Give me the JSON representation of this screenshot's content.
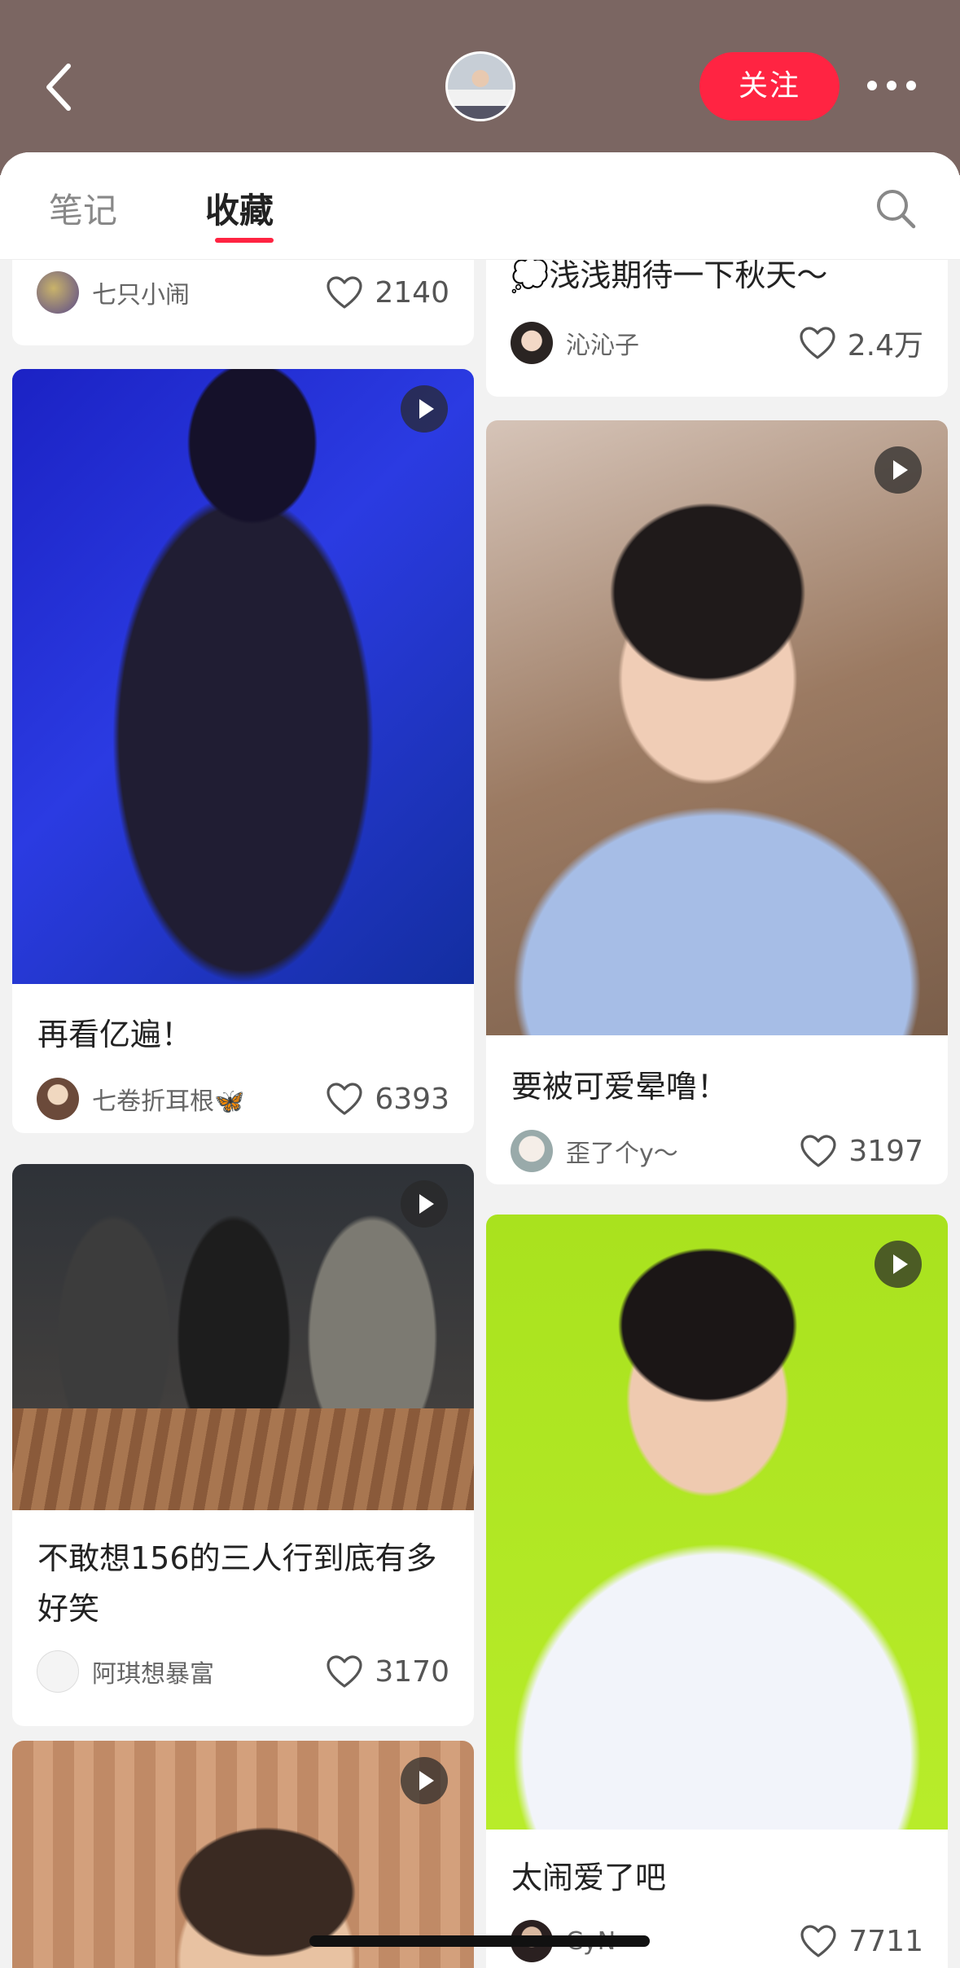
{
  "header": {
    "back_icon": "chevron-left-icon",
    "follow_label": "关注",
    "more_icon": "more-dots-icon"
  },
  "tabs": [
    {
      "label": "笔记",
      "active": false
    },
    {
      "label": "收藏",
      "active": true
    }
  ],
  "search_icon": "search-icon",
  "accent_color": "#ff2442",
  "feed": {
    "left": [
      {
        "title": "",
        "author": "七只小闹",
        "likes": "2140",
        "video": false
      },
      {
        "title": "再看亿遍！",
        "author": "七卷折耳根🦋",
        "likes": "6393",
        "video": true
      },
      {
        "title": "不敢想156的三人行到底有多好笑",
        "author": "阿琪想暴富",
        "likes": "3170",
        "video": true
      },
      {
        "title": "",
        "author": "",
        "likes": "",
        "video": true
      }
    ],
    "right": [
      {
        "title": "💭浅浅期待一下秋天～",
        "author": "沁沁子",
        "likes": "2.4万",
        "video": false
      },
      {
        "title": "要被可爱晕噜！",
        "author": "歪了个y～",
        "likes": "3197",
        "video": true
      },
      {
        "title": "太闹爱了吧",
        "author": "CyN",
        "likes": "7711",
        "video": true
      }
    ]
  }
}
